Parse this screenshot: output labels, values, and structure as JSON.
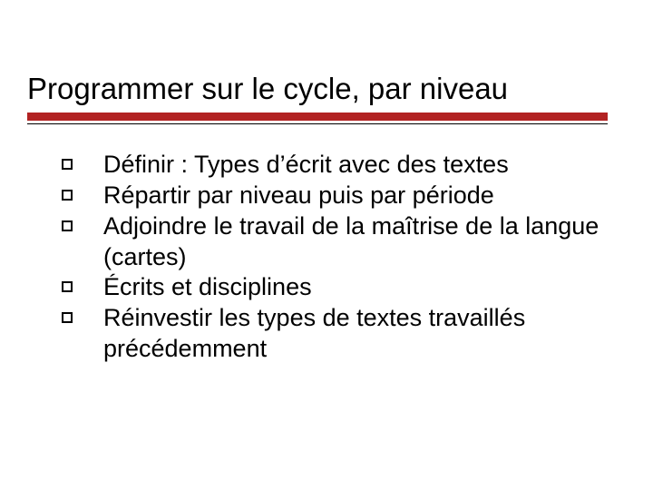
{
  "slide": {
    "title": "Programmer sur le cycle, par niveau",
    "bullets": [
      "Définir : Types d’écrit avec des textes",
      "Répartir par niveau puis par période",
      "Adjoindre le travail de la maîtrise de la langue (cartes)",
      "Écrits et disciplines",
      "Réinvestir les types de textes travaillés précédemment"
    ]
  }
}
